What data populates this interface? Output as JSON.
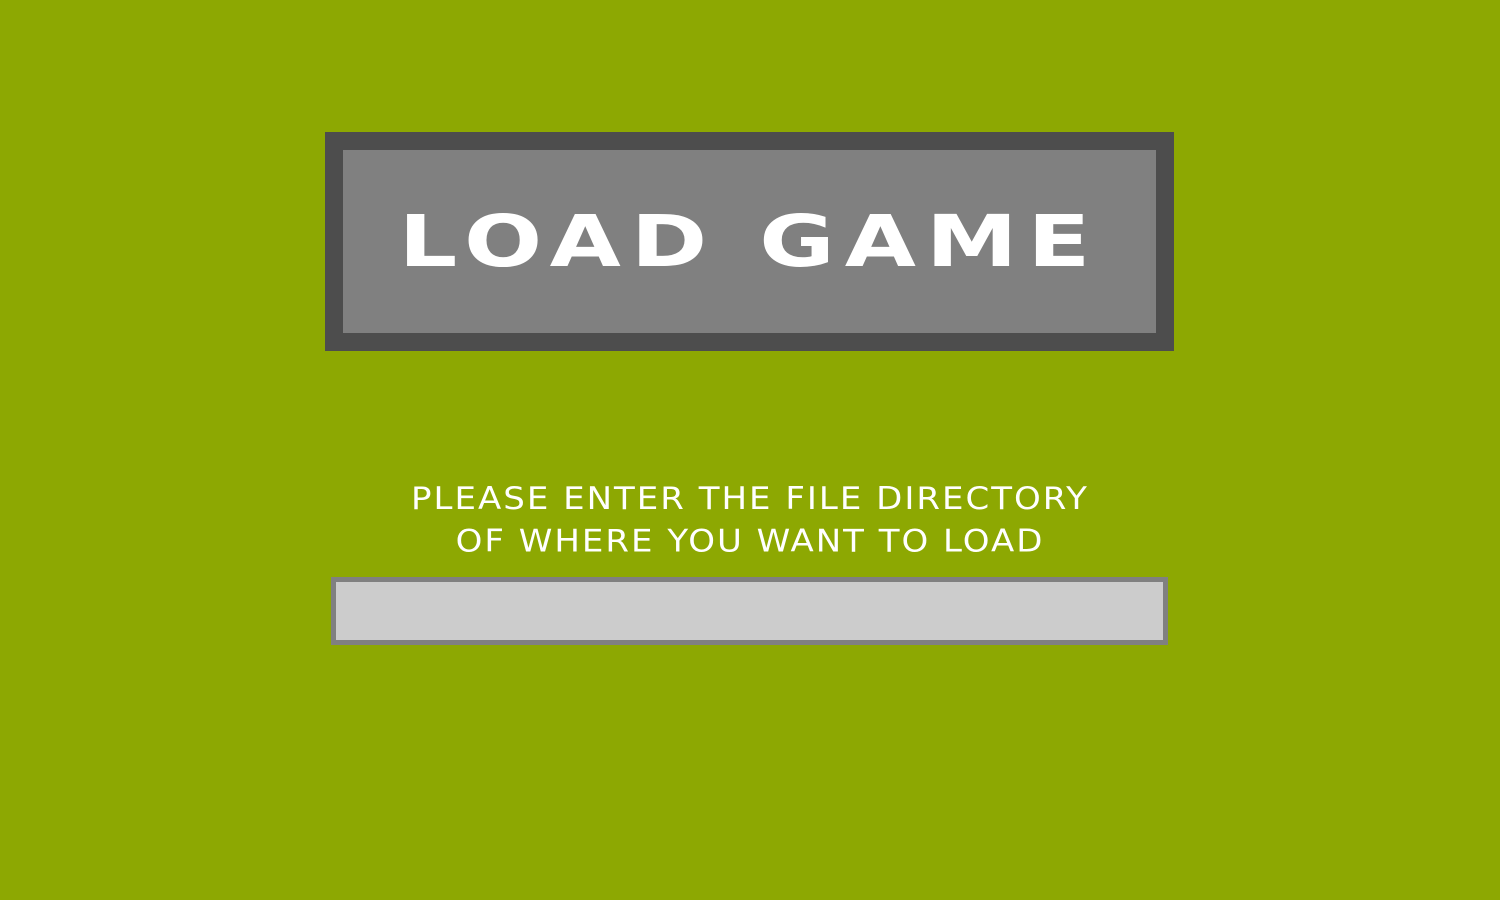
{
  "screen": {
    "title": "LOAD GAME",
    "prompt_line_1": "PLEASE ENTER THE FILE DIRECTORY",
    "prompt_line_2": "OF WHERE YOU WANT TO LOAD",
    "directory_input": {
      "value": "",
      "placeholder": ""
    }
  },
  "colors": {
    "background": "#8da802",
    "title_frame": "#4d4d4d",
    "title_fill": "#808080",
    "text": "#ffffff",
    "input_fill": "#cccccc",
    "input_border": "#808080"
  }
}
